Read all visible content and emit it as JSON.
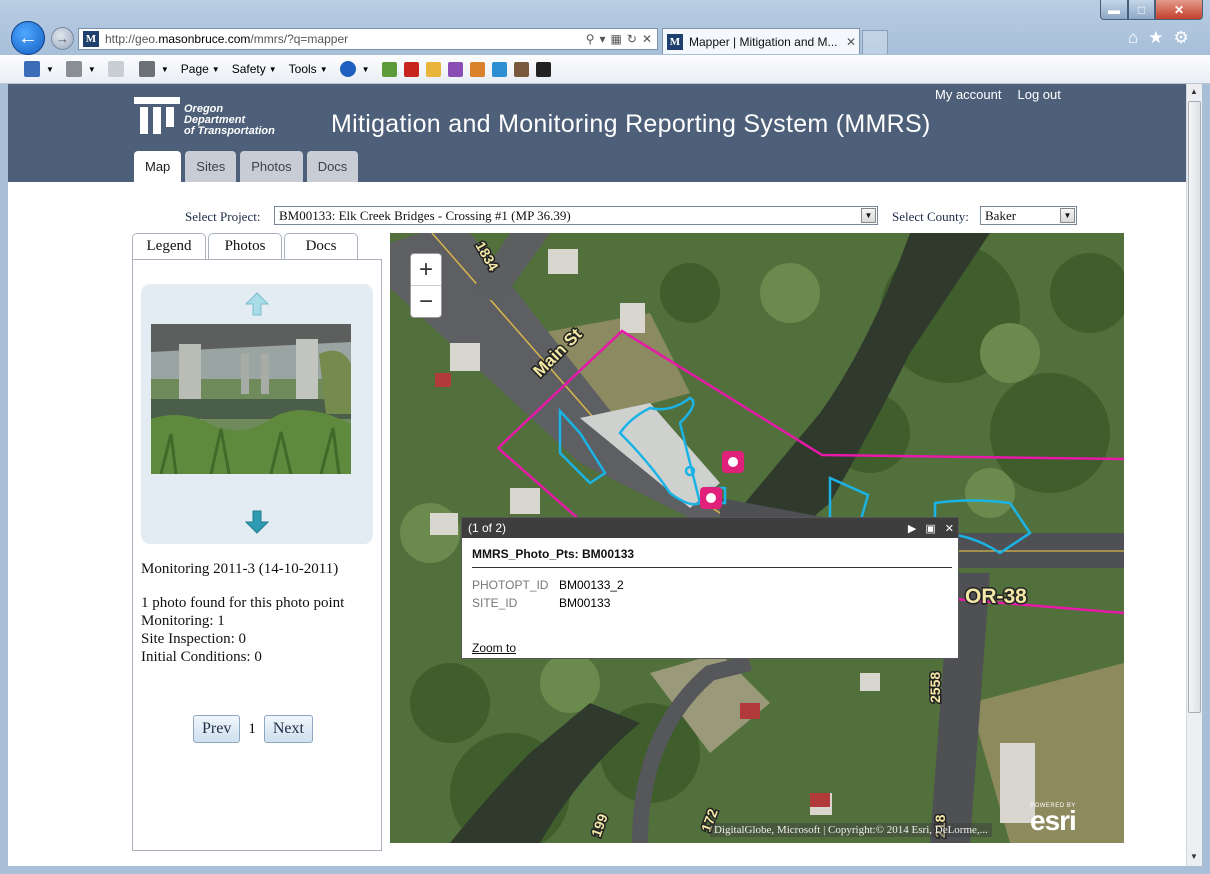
{
  "browser": {
    "url_prefix": "http://geo.",
    "url_domain": "masonbruce.com",
    "url_path": "/mmrs/?q=mapper",
    "tab_title": "Mapper | Mitigation and M...",
    "favicon_letter": "M",
    "commands": {
      "page": "Page",
      "safety": "Safety",
      "tools": "Tools"
    }
  },
  "header": {
    "logo_lines": [
      "Oregon",
      "Department",
      "of Transportation"
    ],
    "title": "Mitigation and Monitoring Reporting System (MMRS)",
    "links": {
      "account": "My account",
      "logout": "Log out"
    },
    "tabs": [
      "Map",
      "Sites",
      "Photos",
      "Docs"
    ],
    "active_tab": "Map"
  },
  "selectors": {
    "project_label": "Select Project:",
    "project_value": "BM00133: Elk Creek Bridges - Crossing #1 (MP 36.39)",
    "county_label": "Select County:",
    "county_value": "Baker"
  },
  "side_panel": {
    "tabs": [
      "Legend",
      "Photos",
      "Docs"
    ],
    "caption": "Monitoring 2011-3 (14-10-2011)",
    "found": "1 photo found for this photo point",
    "monitoring": "Monitoring: 1",
    "inspection": "Site Inspection: 0",
    "initial": "Initial Conditions: 0",
    "pager": {
      "prev": "Prev",
      "page": "1",
      "next": "Next"
    }
  },
  "map": {
    "road_labels": {
      "main": "Main St",
      "or38": "OR-38",
      "r2558": "2558",
      "r1834": "1834",
      "r199": "199",
      "r172": "172",
      "r218": "218"
    },
    "popup": {
      "counter": "(1 of 2)",
      "title": "MMRS_Photo_Pts: BM00133",
      "rows": [
        {
          "key": "PHOTOPT_ID",
          "value": "BM00133_2"
        },
        {
          "key": "SITE_ID",
          "value": "BM00133"
        }
      ],
      "zoom_link": "Zoom to"
    },
    "attribution": "DigitalGlobe, Microsoft | Copyright:© 2014 Esri, DeLorme,...",
    "esri_powered": "POWERED BY",
    "esri_name": "esri",
    "colors": {
      "parcel": "#e619a8",
      "wetland": "#1bb3e6",
      "photo_point": "#e0207a"
    }
  }
}
